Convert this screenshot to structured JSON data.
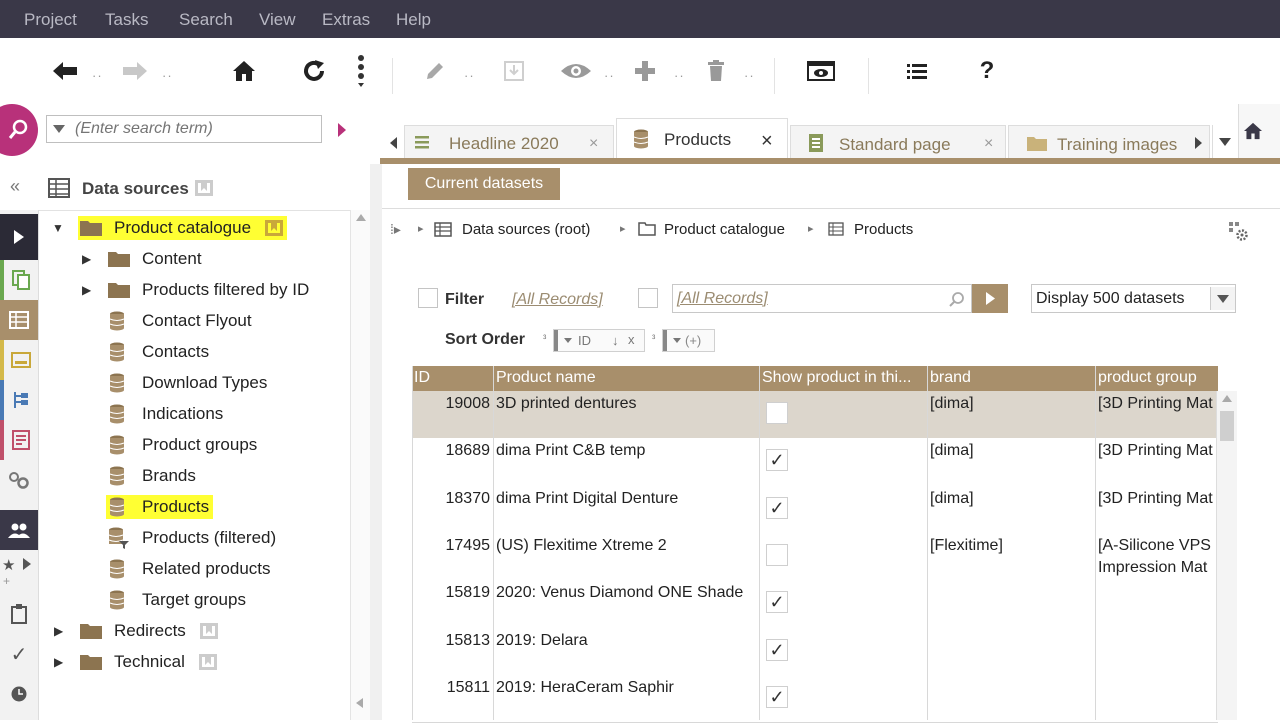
{
  "menubar": {
    "items": [
      "Project",
      "Tasks",
      "Search",
      "View",
      "Extras",
      "Help"
    ]
  },
  "search": {
    "placeholder": "(Enter search term)"
  },
  "tabs": [
    {
      "label": "Headline 2020",
      "icon": "list-icon"
    },
    {
      "label": "Products",
      "icon": "database-icon"
    },
    {
      "label": "Standard page",
      "icon": "page-icon"
    },
    {
      "label": "Training images",
      "icon": "folder-icon"
    }
  ],
  "left_panel": {
    "title": "Data sources",
    "tree": [
      {
        "label": "Product catalogue",
        "icon": "folder-icon",
        "level": 0,
        "expanded": true,
        "highlighted": true
      },
      {
        "label": "Content",
        "icon": "folder-icon",
        "level": 1
      },
      {
        "label": "Products filtered by ID",
        "icon": "folder-icon",
        "level": 1
      },
      {
        "label": "Contact Flyout",
        "icon": "database-icon",
        "level": 1
      },
      {
        "label": "Contacts",
        "icon": "database-icon",
        "level": 1
      },
      {
        "label": "Download Types",
        "icon": "database-icon",
        "level": 1
      },
      {
        "label": "Indications",
        "icon": "database-icon",
        "level": 1
      },
      {
        "label": "Product groups",
        "icon": "database-icon",
        "level": 1
      },
      {
        "label": "Brands",
        "icon": "database-icon",
        "level": 1
      },
      {
        "label": "Products",
        "icon": "database-icon",
        "level": 1,
        "highlighted": true
      },
      {
        "label": "Products (filtered)",
        "icon": "database-filter-icon",
        "level": 1
      },
      {
        "label": "Related products",
        "icon": "database-icon",
        "level": 1
      },
      {
        "label": "Target groups",
        "icon": "database-icon",
        "level": 1
      },
      {
        "label": "Redirects",
        "icon": "folder-icon",
        "level": 0
      },
      {
        "label": "Technical",
        "icon": "folder-icon",
        "level": 0
      }
    ]
  },
  "content": {
    "section_tab": "Current datasets",
    "breadcrumb": [
      "Data sources (root)",
      "Product catalogue",
      "Products"
    ],
    "filter_label": "Filter",
    "filter_value": "[All Records]",
    "filter_field_value": "[All Records]",
    "display_select": "Display 500 datasets",
    "sort_label": "Sort Order",
    "sort_field": "ID",
    "sort_add": "(+)"
  },
  "grid": {
    "columns": [
      "ID",
      "Product name",
      "Show product in thi...",
      "brand",
      "product group"
    ],
    "rows": [
      {
        "id": "19008",
        "name": "3D printed dentures",
        "show": false,
        "brand": "[dima]",
        "group": "[3D Printing Mat",
        "selected": true
      },
      {
        "id": "18689",
        "name": "dima Print C&B temp",
        "show": true,
        "brand": "[dima]",
        "group": "[3D Printing Mat"
      },
      {
        "id": "18370",
        "name": "dima Print Digital Denture",
        "show": true,
        "brand": "[dima]",
        "group": "[3D Printing Mat"
      },
      {
        "id": "17495",
        "name": "(US) Flexitime Xtreme 2",
        "show": false,
        "brand": "[Flexitime]",
        "group": "[A-Silicone VPS Impression Mat"
      },
      {
        "id": "15819",
        "name": " 2020: Venus Diamond ONE Shade",
        "show": true,
        "brand": "",
        "group": ""
      },
      {
        "id": "15813",
        "name": "2019: Delara",
        "show": true,
        "brand": "",
        "group": ""
      },
      {
        "id": "15811",
        "name": " 2019: HeraCeram Saphir",
        "show": true,
        "brand": "",
        "group": ""
      }
    ]
  },
  "colors": {
    "menubar": "#3a3848",
    "accent": "#a88f6b",
    "search_badge": "#b8317a",
    "highlight": "#ffff33"
  }
}
